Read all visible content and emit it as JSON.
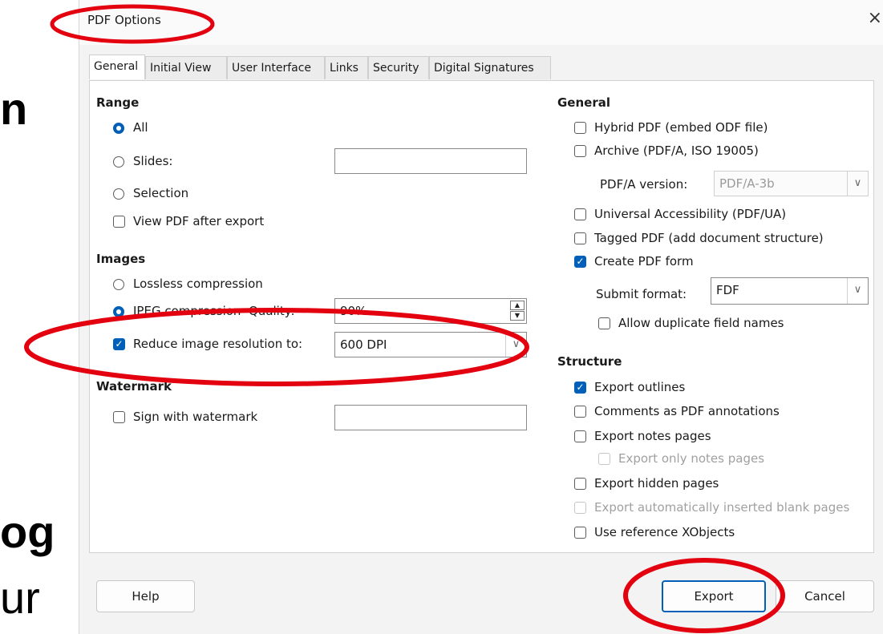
{
  "background": {
    "line1": "n",
    "line2": "og",
    "line3": "ur"
  },
  "dialog": {
    "title": "PDF Options",
    "close_glyph": "×",
    "tabs": [
      {
        "label": "General",
        "active": true
      },
      {
        "label": "Initial View"
      },
      {
        "label": "User Interface"
      },
      {
        "label": "Links"
      },
      {
        "label": "Security"
      },
      {
        "label": "Digital Signatures"
      }
    ],
    "left": {
      "range": {
        "heading": "Range",
        "all": "All",
        "slides": "Slides:",
        "slides_value": "",
        "selection": "Selection",
        "view_after_export": "View PDF after export"
      },
      "images": {
        "heading": "Images",
        "lossless": "Lossless compression",
        "jpeg": "JPEG compression",
        "quality_label": "Quality:",
        "quality_value": "90%",
        "reduce_label": "Reduce image resolution to:",
        "reduce_value": "600 DPI"
      },
      "watermark": {
        "heading": "Watermark",
        "sign": "Sign with watermark",
        "sign_value": ""
      }
    },
    "right": {
      "general": {
        "heading": "General",
        "hybrid": "Hybrid PDF (embed ODF file)",
        "archive": "Archive (PDF/A, ISO 19005)",
        "pdfa_label": "PDF/A version:",
        "pdfa_value": "PDF/A-3b",
        "ua": "Universal Accessibility (PDF/UA)",
        "tagged": "Tagged PDF (add document structure)",
        "form": "Create PDF form",
        "submit_label": "Submit format:",
        "submit_value": "FDF",
        "allow_dup": "Allow duplicate field names"
      },
      "structure": {
        "heading": "Structure",
        "outlines": "Export outlines",
        "comments": "Comments as PDF annotations",
        "notes": "Export notes pages",
        "only_notes": "Export only notes pages",
        "hidden": "Export hidden pages",
        "auto_blank": "Export automatically inserted blank pages",
        "xobjects": "Use reference XObjects"
      }
    },
    "buttons": {
      "help": "Help",
      "export": "Export",
      "cancel": "Cancel"
    },
    "check_glyph": "✓",
    "spin_up": "▲",
    "spin_down": "▼",
    "dd_arrow": "∨"
  },
  "annotation_color": "#e3000f"
}
